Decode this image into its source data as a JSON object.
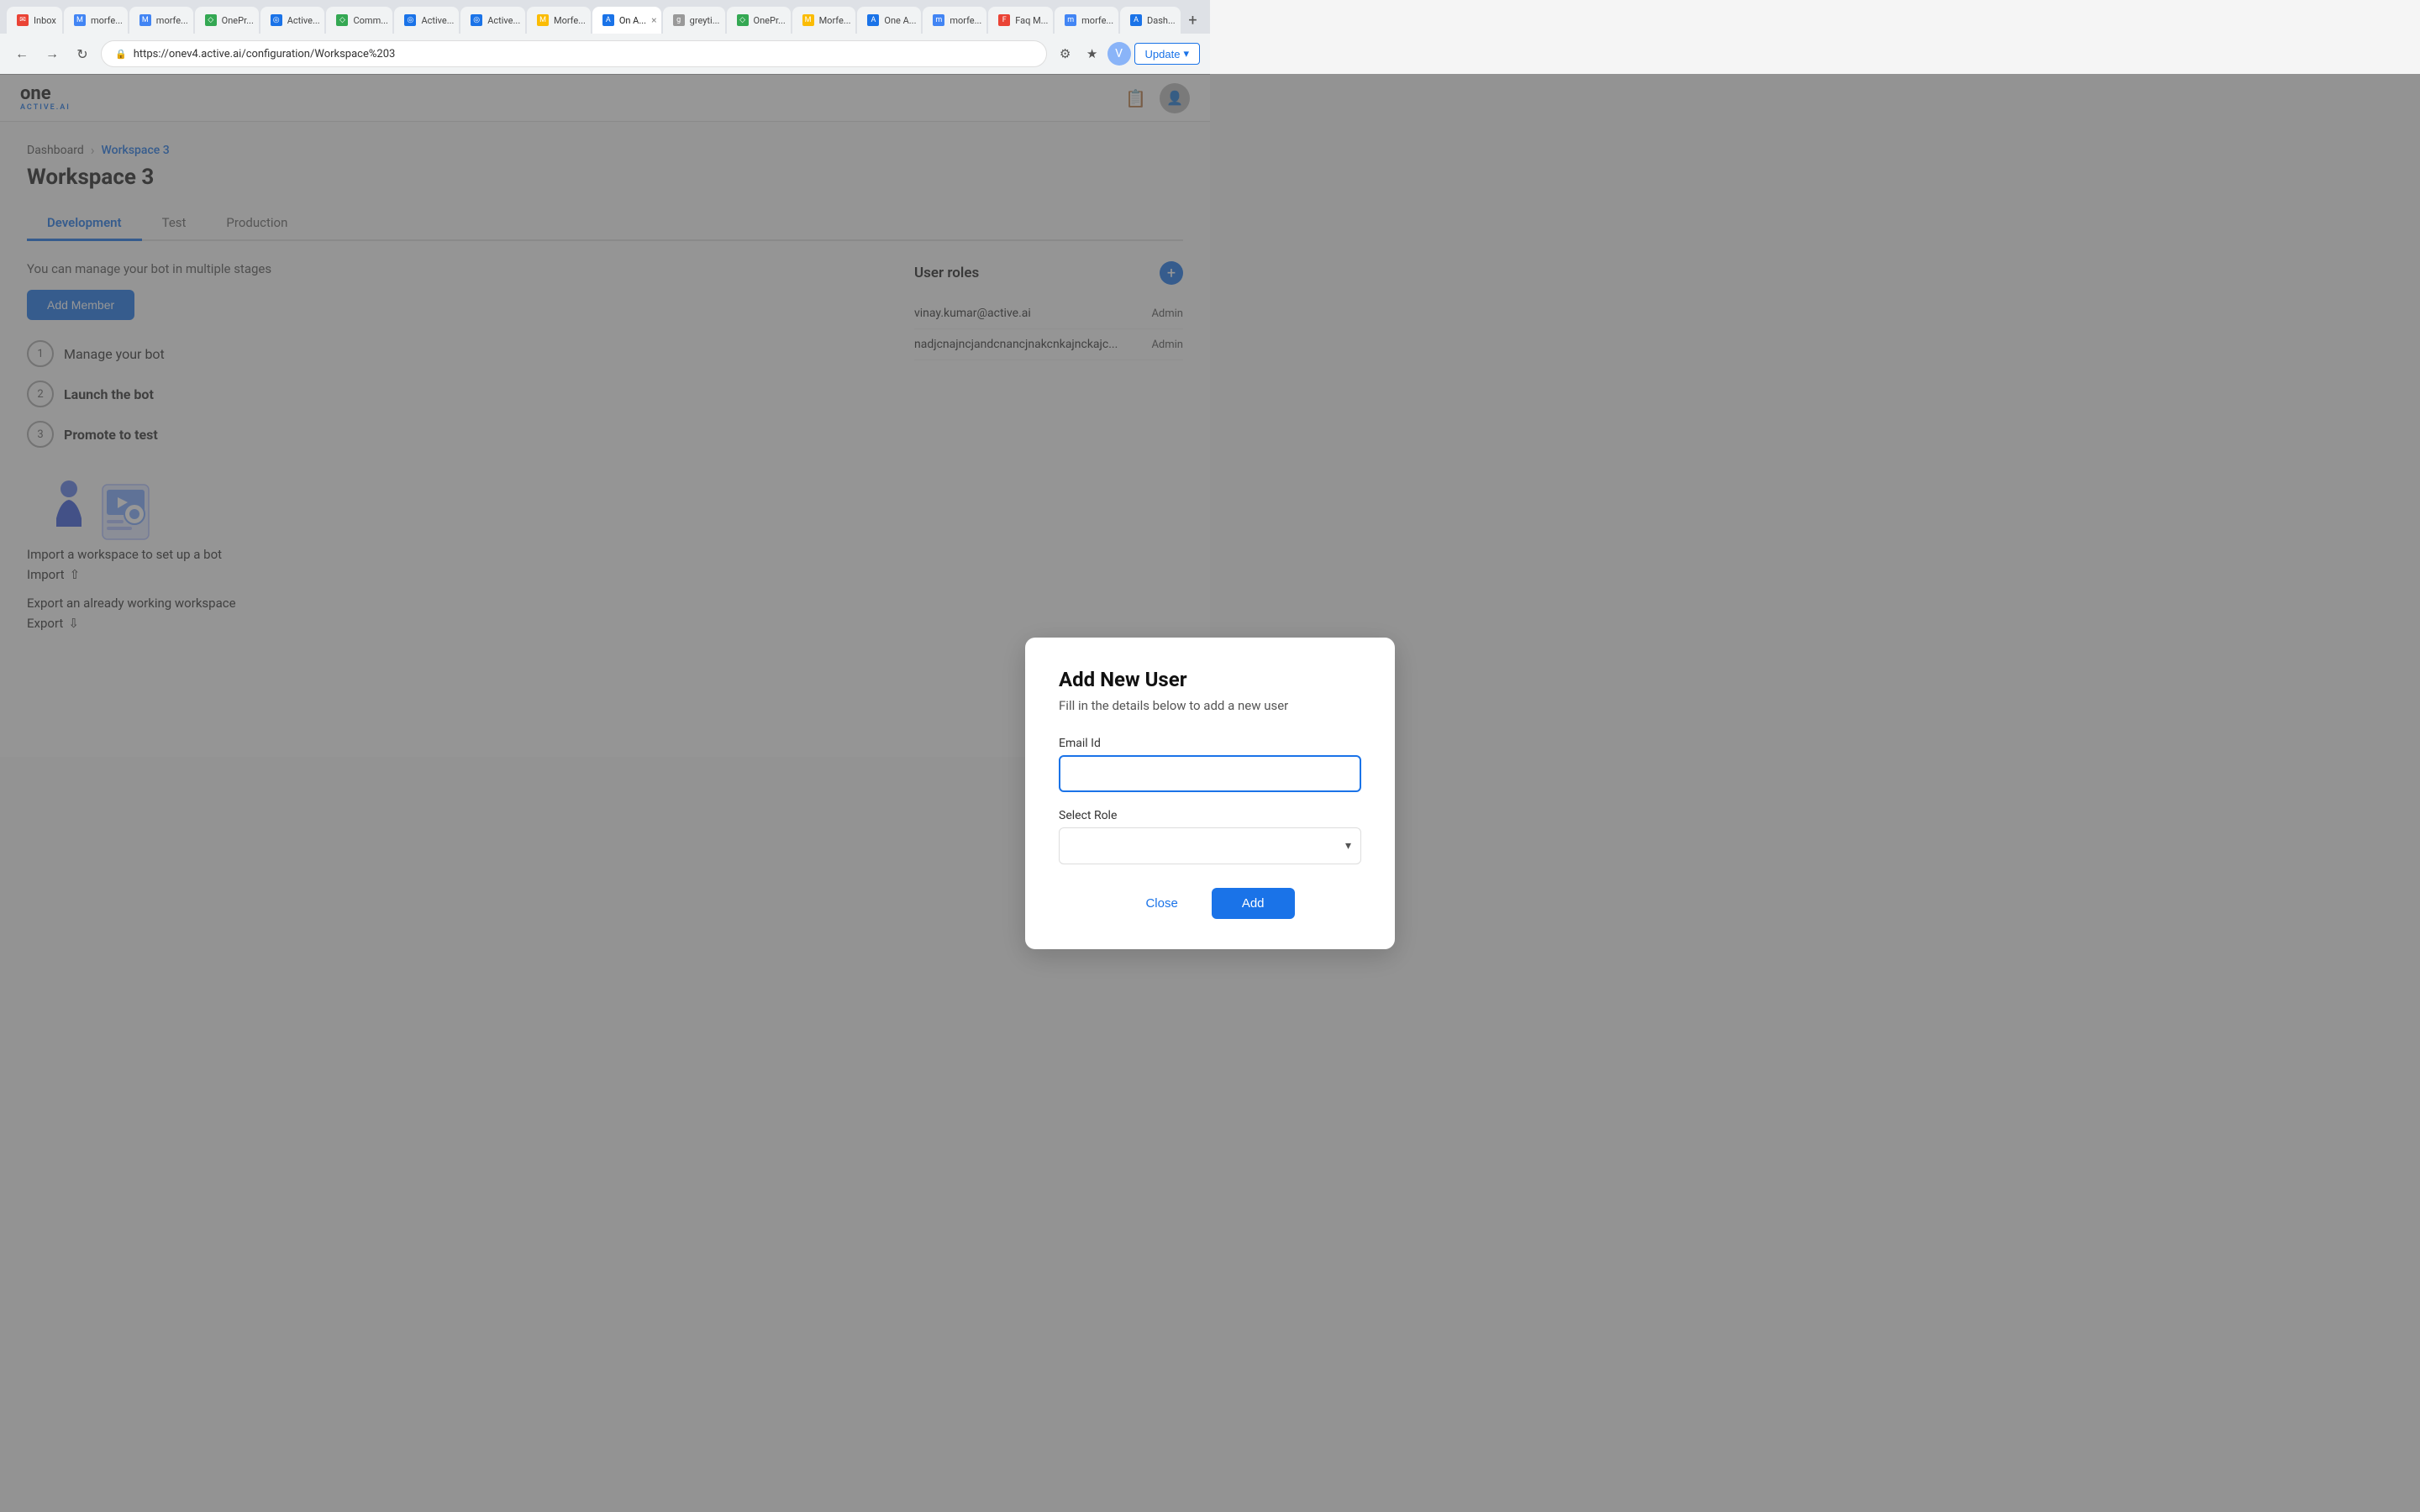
{
  "browser": {
    "url": "https://onev4.active.ai/configuration/Workspace%203",
    "update_button": "Update",
    "tabs": [
      {
        "label": "Inbox",
        "favicon": "✉",
        "active": false
      },
      {
        "label": "morfe...",
        "favicon": "M",
        "active": false
      },
      {
        "label": "morfe...",
        "favicon": "M",
        "active": false
      },
      {
        "label": "OnePr...",
        "favicon": "◇",
        "active": false
      },
      {
        "label": "Active...",
        "favicon": "◎",
        "active": false
      },
      {
        "label": "Comm...",
        "favicon": "◇",
        "active": false
      },
      {
        "label": "Active...",
        "favicon": "◎",
        "active": false
      },
      {
        "label": "Active...",
        "favicon": "◎",
        "active": false
      },
      {
        "label": "Morfe...",
        "favicon": "M",
        "active": false
      },
      {
        "label": "On A...",
        "favicon": "A",
        "active": true
      },
      {
        "label": "greyti...",
        "favicon": "g",
        "active": false
      },
      {
        "label": "OnePr...",
        "favicon": "◇",
        "active": false
      },
      {
        "label": "Morfe...",
        "favicon": "M",
        "active": false
      },
      {
        "label": "One A...",
        "favicon": "A",
        "active": false
      },
      {
        "label": "morfe...",
        "favicon": "m",
        "active": false
      },
      {
        "label": "Faq M...",
        "favicon": "F",
        "active": false
      },
      {
        "label": "morfe...",
        "favicon": "m",
        "active": false
      },
      {
        "label": "Dash...",
        "favicon": "A",
        "active": false
      }
    ]
  },
  "app": {
    "logo": {
      "text": "one",
      "sub": "ACTIVE.AI"
    }
  },
  "breadcrumb": {
    "dashboard": "Dashboard",
    "separator": "›",
    "current": "Workspace 3"
  },
  "page": {
    "title": "Workspace 3"
  },
  "tabs": [
    {
      "label": "Development",
      "active": true
    },
    {
      "label": "Test",
      "active": false
    },
    {
      "label": "Production",
      "active": false
    }
  ],
  "content": {
    "hint_text": "You can manage your bot in multiple stages",
    "add_member_button": "Add Member",
    "steps": [
      {
        "number": "1",
        "label": "Manage your bot"
      },
      {
        "number": "2",
        "label": "Launch the bot",
        "bold": true
      },
      {
        "number": "3",
        "label": "Promote to test",
        "bold": true
      }
    ],
    "import_desc": "Import a workspace to set up a bot",
    "import_label": "Import",
    "export_desc": "Export an already working workspace",
    "export_label": "Export"
  },
  "user_roles": {
    "title": "User roles",
    "users": [
      {
        "email": "vinay.kumar@active.ai",
        "role": "Admin"
      },
      {
        "email": "nadjcnajncjandcnancjnakcnkajnckajc...",
        "role": "Admin"
      }
    ]
  },
  "modal": {
    "title": "Add New User",
    "subtitle": "Fill in the details below to add a new user",
    "email_label": "Email Id",
    "email_placeholder": "",
    "role_label": "Select Role",
    "close_button": "Close",
    "add_button": "Add"
  }
}
